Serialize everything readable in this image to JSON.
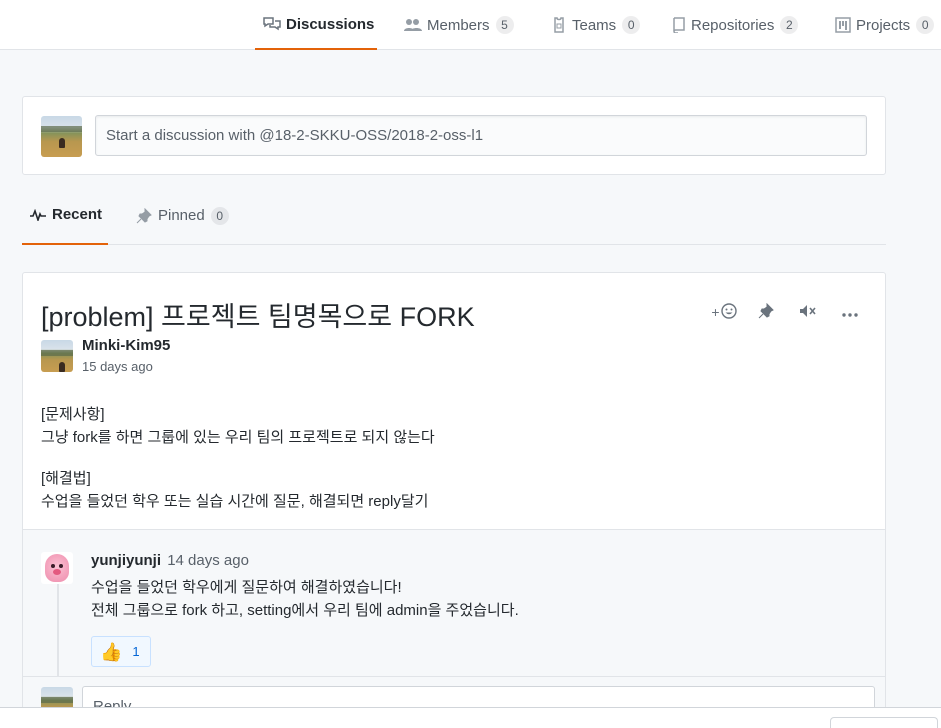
{
  "nav": {
    "tabs": [
      {
        "label": "Discussions",
        "icon": "comment-discussion-icon",
        "selected": true
      },
      {
        "label": "Members",
        "count": "5",
        "icon": "people-icon"
      },
      {
        "label": "Teams",
        "count": "0",
        "icon": "jersey-icon"
      },
      {
        "label": "Repositories",
        "count": "2",
        "icon": "repo-icon"
      },
      {
        "label": "Projects",
        "count": "0",
        "icon": "project-icon"
      }
    ]
  },
  "composer": {
    "placeholder": "Start a discussion with @18-2-SKKU-OSS/2018-2-oss-l1"
  },
  "subtabs": [
    {
      "label": "Recent",
      "icon": "pulse-icon",
      "selected": true
    },
    {
      "label": "Pinned",
      "count": "0",
      "icon": "pin-icon"
    }
  ],
  "post": {
    "title": "[problem] 프로젝트 팀명목으로 FORK",
    "author": "Minki-Kim95",
    "time": "15 days ago",
    "body": [
      [
        "[문제사항]",
        "그냥 fork를 하면 그룹에 있는 우리 팀의 프로젝트로 되지 않는다"
      ],
      [
        "[해결법]",
        "수업을 들었던 학우 또는 실습 시간에 질문, 해결되면 reply달기"
      ]
    ],
    "actions": {
      "reaction_add": "+",
      "icons": [
        "smiley-icon",
        "pin-icon",
        "mute-icon",
        "kebab-menu-icon"
      ]
    }
  },
  "reply": {
    "author": "yunjiyunji",
    "time": "14 days ago",
    "lines": [
      "수업을 들었던 학우에게 질문하여 해결하였습니다!",
      "전체 그룹으로 fork 하고, setting에서 우리 팀에 admin을 주었습니다."
    ],
    "reaction": {
      "emoji": "👍",
      "count": "1"
    }
  },
  "reply_input": {
    "placeholder": "Reply..."
  },
  "colors": {
    "accent": "#e36209",
    "link": "#0366d6",
    "border": "#e1e4e8"
  }
}
